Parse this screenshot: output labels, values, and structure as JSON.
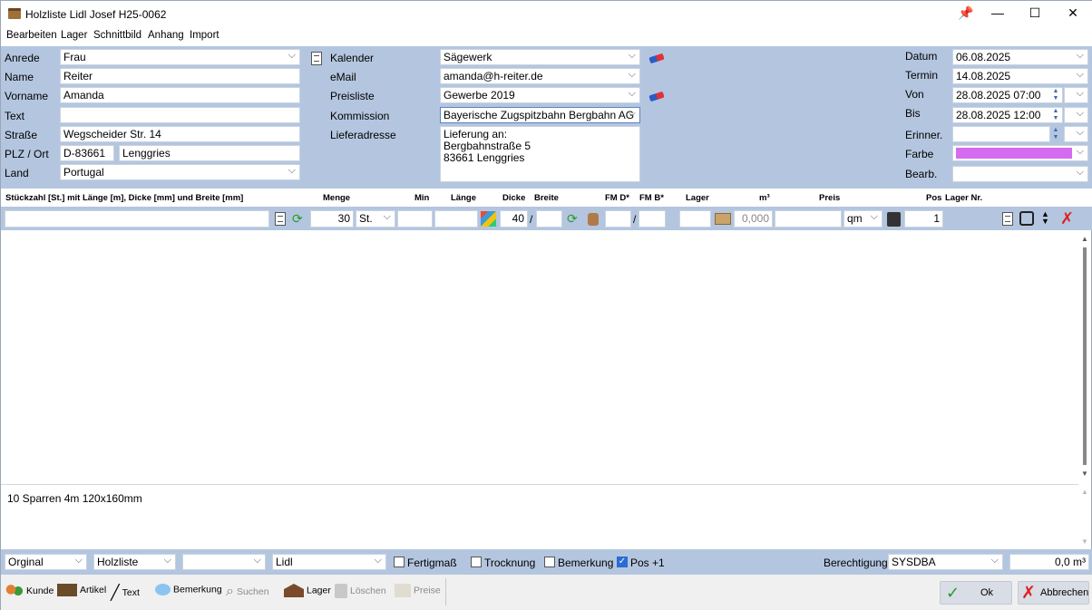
{
  "window": {
    "title": "Holzliste Lidl Josef H25-0062",
    "pin_icon": "pin-icon",
    "min": "—",
    "max": "☐",
    "close": "✕"
  },
  "menu": [
    "Bearbeiten",
    "Lager",
    "Schnittbild",
    "Anhang",
    "Import"
  ],
  "customer": {
    "anrede_label": "Anrede",
    "anrede": "Frau",
    "name_label": "Name",
    "name": "Reiter",
    "vorname_label": "Vorname",
    "vorname": "Amanda",
    "text_label": "Text",
    "text": "",
    "strasse_label": "Straße",
    "strasse": "Wegscheider Str. 14",
    "plz_label": "PLZ / Ort",
    "plz": "D-83661",
    "ort": "Lenggries",
    "land_label": "Land",
    "land": "Portugal"
  },
  "middle": {
    "kalender_label": "Kalender",
    "kalender": "Sägewerk",
    "email_label": "eMail",
    "email": "amanda@h-reiter.de",
    "preisliste_label": "Preisliste",
    "preisliste": "Gewerbe 2019",
    "kommission_label": "Kommission",
    "kommission": "Bayerische Zugspitzbahn Bergbahn AG",
    "lieferadresse_label": "Lieferadresse",
    "lieferadresse": [
      "Lieferung an:",
      "Bergbahnstraße 5",
      "83661 Lenggries"
    ]
  },
  "right": {
    "datum_label": "Datum",
    "datum": "06.08.2025",
    "termin_label": "Termin",
    "termin": "14.08.2025",
    "von_label": "Von",
    "von_date": "28.08.2025",
    "von_time": "07:00",
    "bis_label": "Bis",
    "bis_date": "28.08.2025",
    "bis_time": "12:00",
    "erinner_label": "Erinner.",
    "erinner": "",
    "farbe_label": "Farbe",
    "farbe_color": "#d46bf0",
    "bearb_label": "Bearb.",
    "bearb": ""
  },
  "columns": {
    "stueck": "Stückzahl [St.] mit Länge [m], Dicke [mm] und Breite [mm]",
    "menge": "Menge",
    "min": "Min",
    "laenge": "Länge",
    "dicke": "Dicke",
    "breite": "Breite",
    "fmd": "FM D*",
    "fmb": "FM B*",
    "lager": "Lager",
    "m3": "m³",
    "preis": "Preis",
    "pos": "Pos",
    "lagernr": "Lager Nr."
  },
  "inputrow": {
    "stueck": "",
    "menge": "30",
    "unit": "St.",
    "min": "",
    "laenge": "",
    "dicke": "40",
    "slash1": "/",
    "breite": "",
    "fmd": "",
    "slash2": "/",
    "fmb": "",
    "lager": "",
    "m3": "0,000",
    "preis": "",
    "preis_unit": "qm",
    "pos": "1"
  },
  "notes": "10 Sparren 4m 120x160mm",
  "footer": {
    "sel1": "Orginal",
    "sel2": "Holzliste",
    "sel3": "",
    "sel4": "Lidl",
    "fertigmass": "Fertigmaß",
    "trocknung": "Trocknung",
    "bemerkung": "Bemerkung",
    "pos_plus": "Pos +1",
    "berechtigung_label": "Berechtigung",
    "berechtigung": "SYSDBA",
    "volume": "0,0 m³"
  },
  "toolbar": {
    "kunde": "Kunde",
    "artikel": "Artikel",
    "text": "Text",
    "bemerkung": "Bemerkung",
    "suchen": "Suchen",
    "lager": "Lager",
    "loeschen": "Löschen",
    "preise": "Preise",
    "ok": "Ok",
    "abbrechen": "Abbrechen"
  }
}
